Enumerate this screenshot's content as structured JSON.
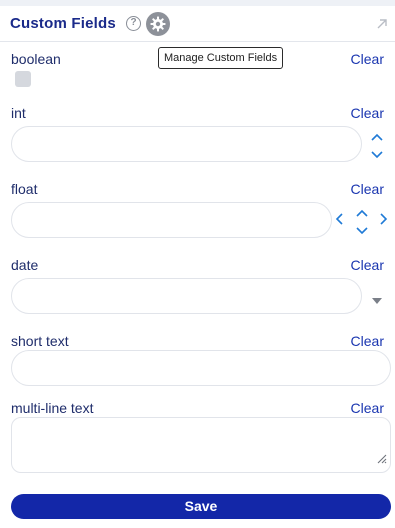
{
  "header": {
    "title": "Custom Fields",
    "help_glyph": "?",
    "icons": [
      "help-icon",
      "gear-icon",
      "expand-icon"
    ],
    "tooltip": "Manage Custom Fields"
  },
  "fields": [
    {
      "label": "boolean",
      "clear": "Clear",
      "type": "checkbox",
      "checked": false
    },
    {
      "label": "int",
      "clear": "Clear",
      "type": "number",
      "value": ""
    },
    {
      "label": "float",
      "clear": "Clear",
      "type": "number",
      "value": ""
    },
    {
      "label": "date",
      "clear": "Clear",
      "type": "date",
      "value": ""
    },
    {
      "label": "short text",
      "clear": "Clear",
      "type": "text",
      "value": ""
    },
    {
      "label": "multi-line text",
      "clear": "Clear",
      "type": "textarea",
      "value": ""
    }
  ],
  "save_label": "Save",
  "colors": {
    "title": "#1a2a8a",
    "link": "#1a36b0",
    "save_button": "#1327a8",
    "stepper": "#1f7ad6"
  }
}
